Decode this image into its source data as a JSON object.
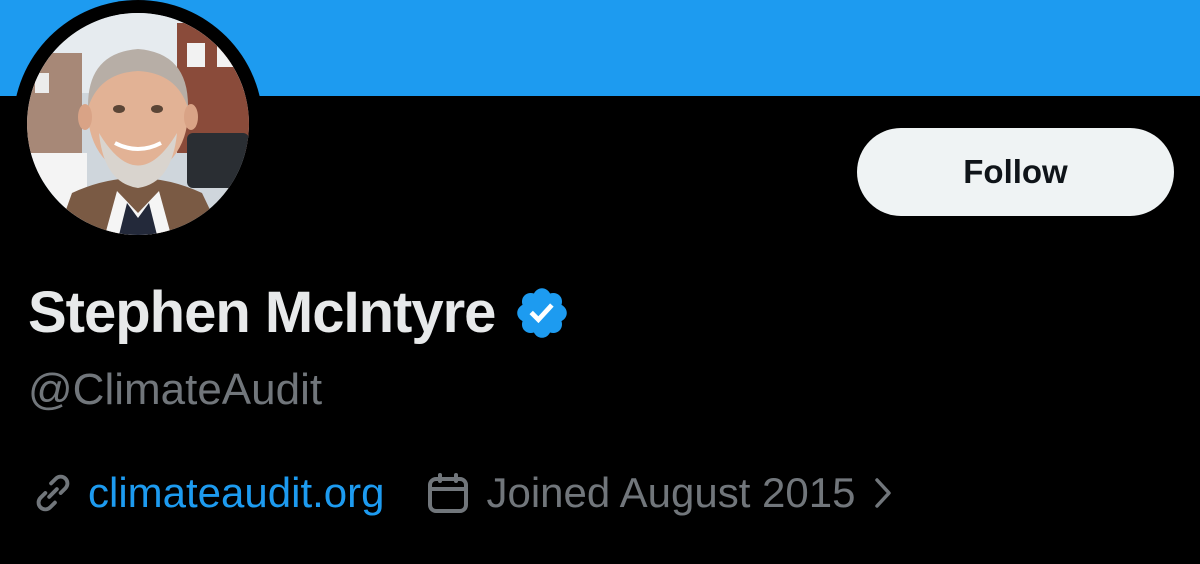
{
  "profile": {
    "display_name": "Stephen McIntyre",
    "handle": "@ClimateAudit",
    "website": "climateaudit.org",
    "joined": "Joined August 2015",
    "verified": true
  },
  "actions": {
    "follow_label": "Follow"
  },
  "icons": {
    "verified": "verified-badge-icon",
    "link": "link-icon",
    "calendar": "calendar-icon",
    "chevron": "chevron-right-icon"
  },
  "colors": {
    "banner": "#1d9bf0",
    "background": "#000000",
    "accent": "#1d9bf0",
    "name": "#e7e9ea",
    "secondary": "#71767b",
    "button_bg": "#eff3f4"
  }
}
